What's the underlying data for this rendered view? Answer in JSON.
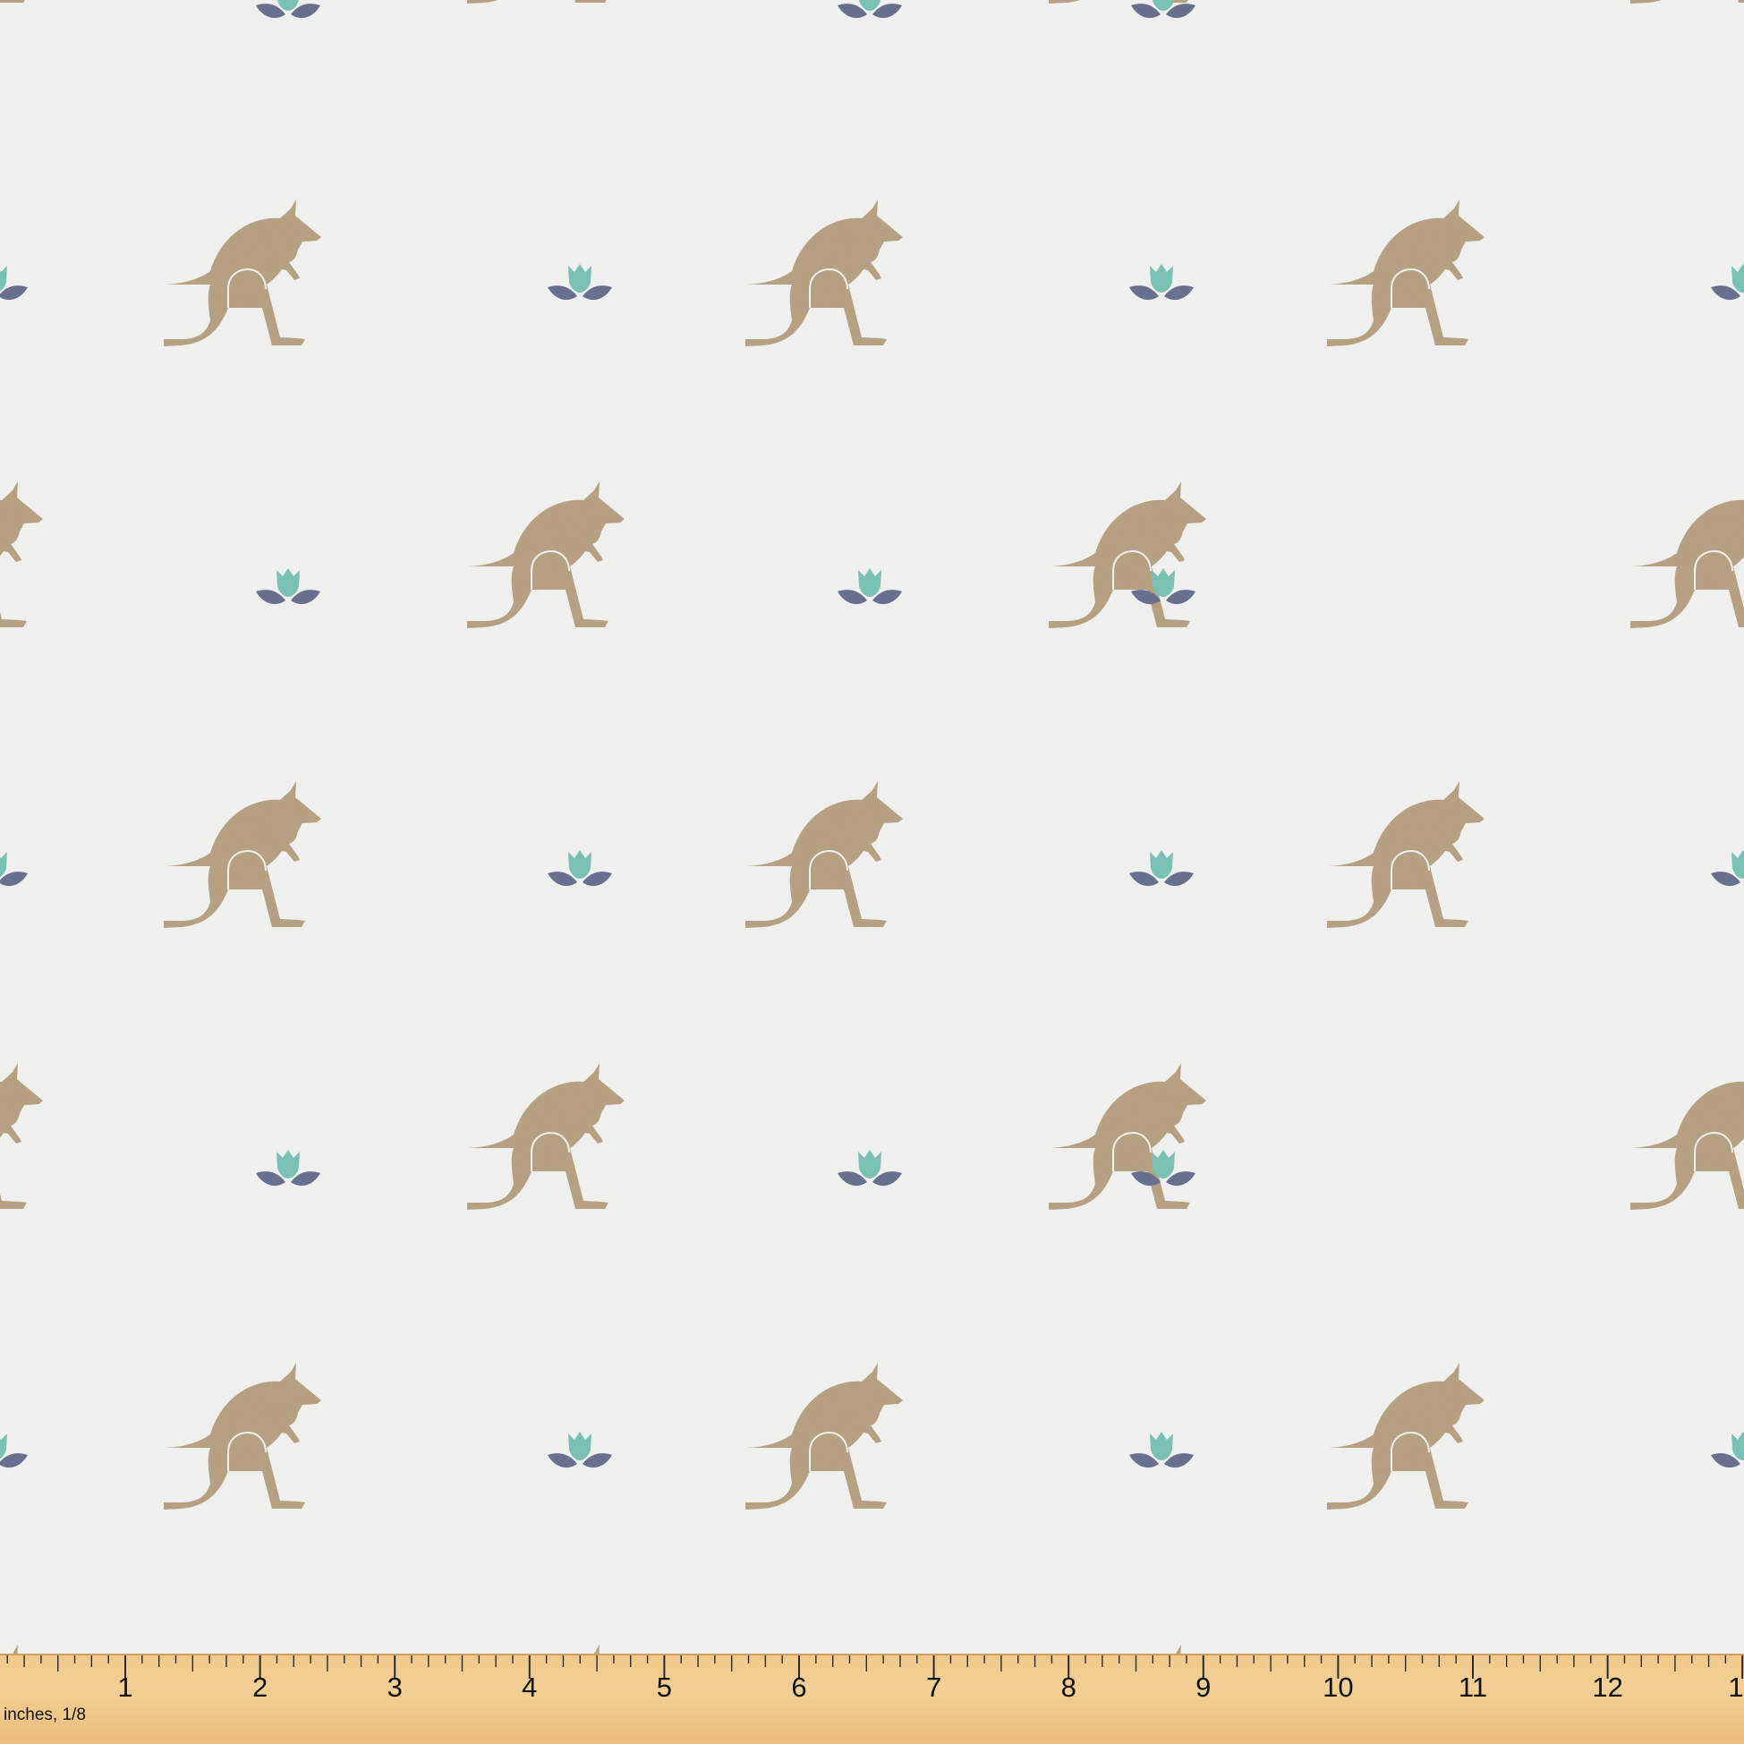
{
  "pattern": {
    "background_color": "#f2f2f0",
    "kangaroo_color": "#b59f7f",
    "flower_petal_color": "#76c1b4",
    "flower_leaf_color": "#636c8c"
  },
  "ruler": {
    "unit_label": "inches, 1/8",
    "numbers": [
      "1",
      "2",
      "3",
      "4",
      "5",
      "6",
      "7",
      "8",
      "9",
      "10",
      "11",
      "12",
      "1"
    ]
  }
}
